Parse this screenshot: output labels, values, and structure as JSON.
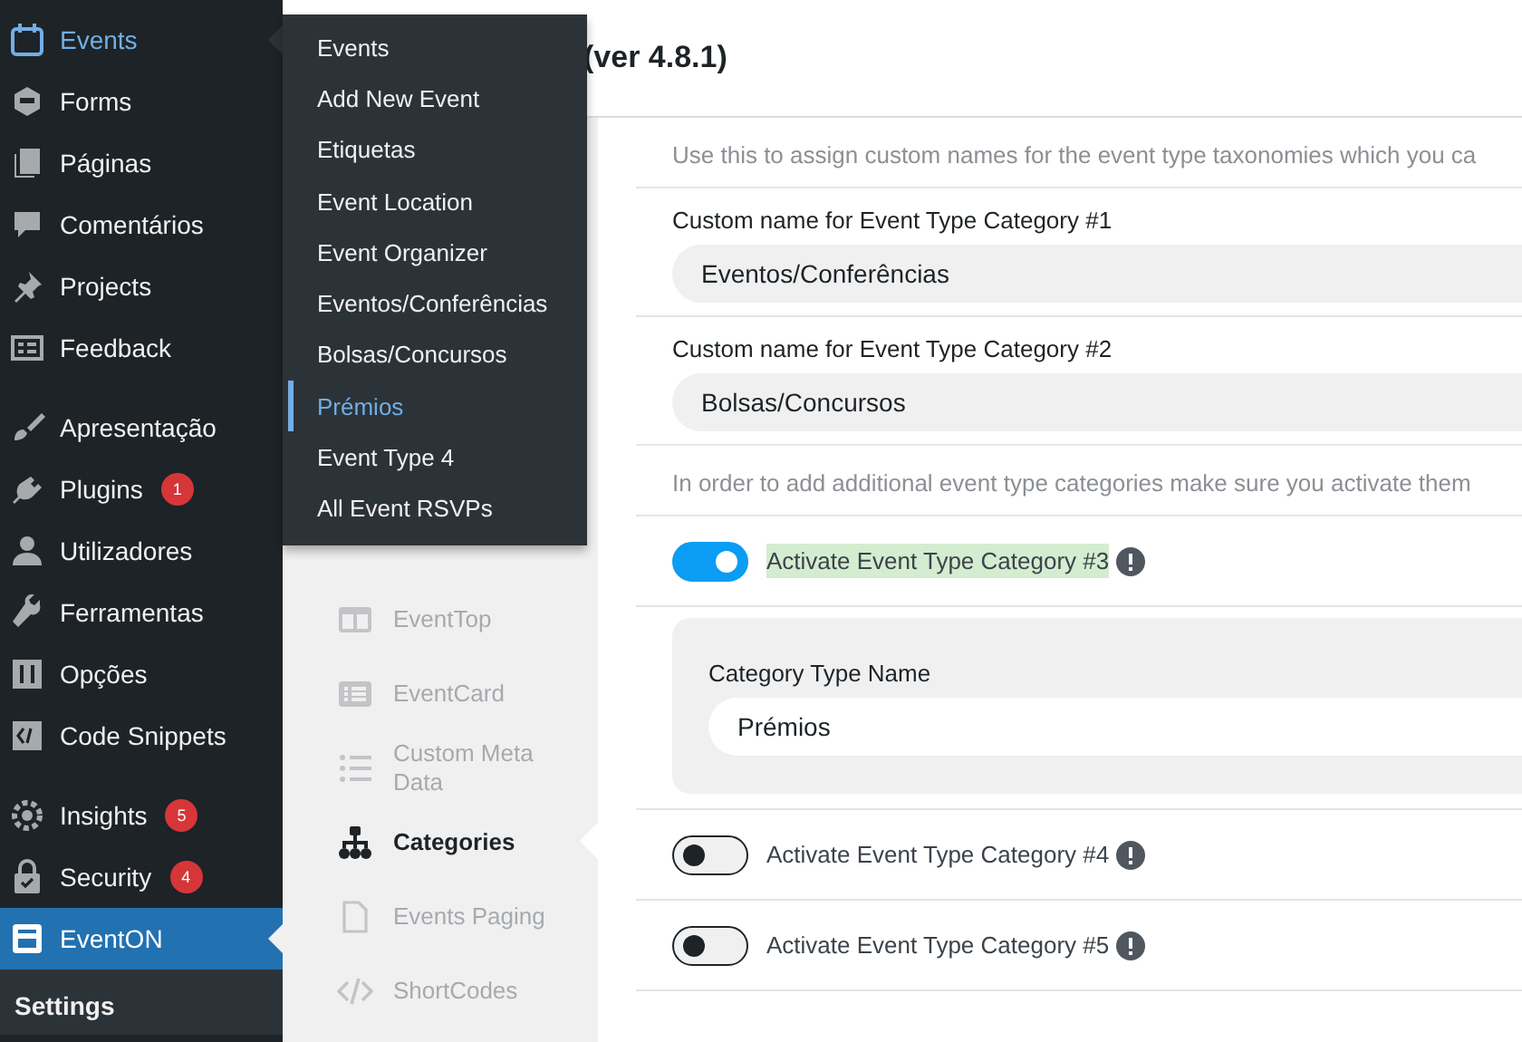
{
  "sidebar": {
    "groups": [
      [
        {
          "label": "Events",
          "open": true,
          "selected": false
        },
        {
          "label": "Forms",
          "open": false,
          "selected": false
        },
        {
          "label": "Páginas",
          "open": false,
          "selected": false
        },
        {
          "label": "Comentários",
          "open": false,
          "selected": false
        },
        {
          "label": "Projects",
          "open": false,
          "selected": false
        },
        {
          "label": "Feedback",
          "open": false,
          "selected": false
        }
      ],
      [
        {
          "label": "Apresentação",
          "open": false,
          "selected": false
        },
        {
          "label": "Plugins",
          "badge": "1",
          "open": false,
          "selected": false
        },
        {
          "label": "Utilizadores",
          "open": false,
          "selected": false
        },
        {
          "label": "Ferramentas",
          "open": false,
          "selected": false
        },
        {
          "label": "Opções",
          "open": false,
          "selected": false
        },
        {
          "label": "Code Snippets",
          "open": false,
          "selected": false
        }
      ],
      [
        {
          "label": "Insights",
          "badge": "5",
          "open": false,
          "selected": false
        },
        {
          "label": "Security",
          "badge": "4",
          "open": false,
          "selected": false
        },
        {
          "label": "EventON",
          "open": false,
          "selected": true,
          "submenu": [
            {
              "label": "Settings",
              "selected": true
            }
          ]
        }
      ]
    ]
  },
  "flyout": {
    "items": [
      {
        "label": "Events",
        "selected": false
      },
      {
        "label": "Add New Event",
        "selected": false
      },
      {
        "label": "Etiquetas",
        "selected": false
      },
      {
        "label": "Event Location",
        "selected": false
      },
      {
        "label": "Event Organizer",
        "selected": false
      },
      {
        "label": "Eventos/Conferências",
        "selected": false
      },
      {
        "label": "Bolsas/Concursos",
        "selected": false
      },
      {
        "label": "Prémios",
        "selected": true
      },
      {
        "label": "Event Type 4",
        "selected": false
      },
      {
        "label": "All Event RSVPs",
        "selected": false
      }
    ]
  },
  "header": {
    "title": "(ver 4.8.1)"
  },
  "settings_nav": {
    "items": [
      {
        "label": "EventTop",
        "selected": false
      },
      {
        "label": "EventCard",
        "selected": false
      },
      {
        "label": "Custom Meta Data",
        "selected": false
      },
      {
        "label": "Categories",
        "selected": true
      },
      {
        "label": "Events Paging",
        "selected": false
      },
      {
        "label": "ShortCodes",
        "selected": false
      }
    ]
  },
  "content": {
    "rows": [
      {
        "kind": "note",
        "text": "Use this to assign custom names for the event type taxonomies which you ca"
      },
      {
        "kind": "text_field",
        "label": "Custom name for Event Type Category #1",
        "value": "Eventos/Conferências"
      },
      {
        "kind": "text_field",
        "label": "Custom name for Event Type Category #2",
        "value": "Bolsas/Concursos"
      },
      {
        "kind": "note",
        "text": "In order to add additional event type categories make sure you activate them"
      },
      {
        "kind": "toggle",
        "label": "Activate Event Type Category #3",
        "on": true,
        "highlighted": true
      },
      {
        "kind": "subpanel",
        "label": "Category Type Name",
        "value": "Prémios"
      },
      {
        "kind": "toggle",
        "label": "Activate Event Type Category #4",
        "on": false,
        "highlighted": false
      },
      {
        "kind": "toggle",
        "label": "Activate Event Type Category #5",
        "on": false,
        "highlighted": false
      }
    ]
  }
}
